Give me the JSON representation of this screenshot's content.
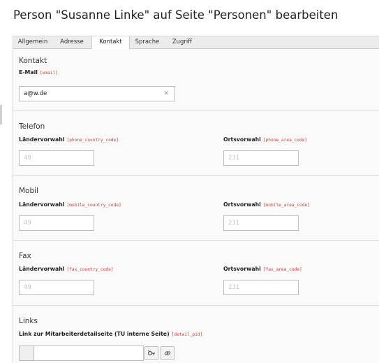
{
  "page": {
    "title": "Person \"Susanne Linke\" auf Seite \"Personen\" bearbeiten"
  },
  "tabs": [
    {
      "label": "Allgemein",
      "active": false
    },
    {
      "label": "Adresse",
      "active": false
    },
    {
      "label": "Kontakt",
      "active": true
    },
    {
      "label": "Sprache",
      "active": false
    },
    {
      "label": "Zugriff",
      "active": false
    }
  ],
  "sections": {
    "kontakt": {
      "title": "Kontakt",
      "email": {
        "label": "E-Mail",
        "key": "[email]",
        "value": "a@w.de",
        "clear_icon": "close-icon"
      }
    },
    "telefon": {
      "title": "Telefon",
      "country": {
        "label": "Ländervorwahl",
        "key": "[phone_country_code]",
        "placeholder": "49"
      },
      "area": {
        "label": "Ortsvorwahl",
        "key": "[phone_area_code]",
        "placeholder": "231"
      }
    },
    "mobil": {
      "title": "Mobil",
      "country": {
        "label": "Ländervorwahl",
        "key": "[mobile_country_code]",
        "placeholder": "49"
      },
      "area": {
        "label": "Ortsvorwahl",
        "key": "[mobile_area_code]",
        "placeholder": "231"
      }
    },
    "fax": {
      "title": "Fax",
      "country": {
        "label": "Ländervorwahl",
        "key": "[fax_country_code]",
        "placeholder": "49"
      },
      "area": {
        "label": "Ortsvorwahl",
        "key": "[fax_area_code]",
        "placeholder": "231"
      }
    },
    "links": {
      "title": "Links",
      "detail": {
        "label": "Link zur Mitarbeiterdetailseite (TU interne Seite)",
        "key": "[detail_pid]",
        "value": ""
      },
      "icons": [
        "link-wizard-icon",
        "chain-link-icon"
      ]
    }
  },
  "colors": {
    "field_key": "#c83c3c",
    "section_bg": "#fafafa",
    "border": "#d7d7d7"
  }
}
